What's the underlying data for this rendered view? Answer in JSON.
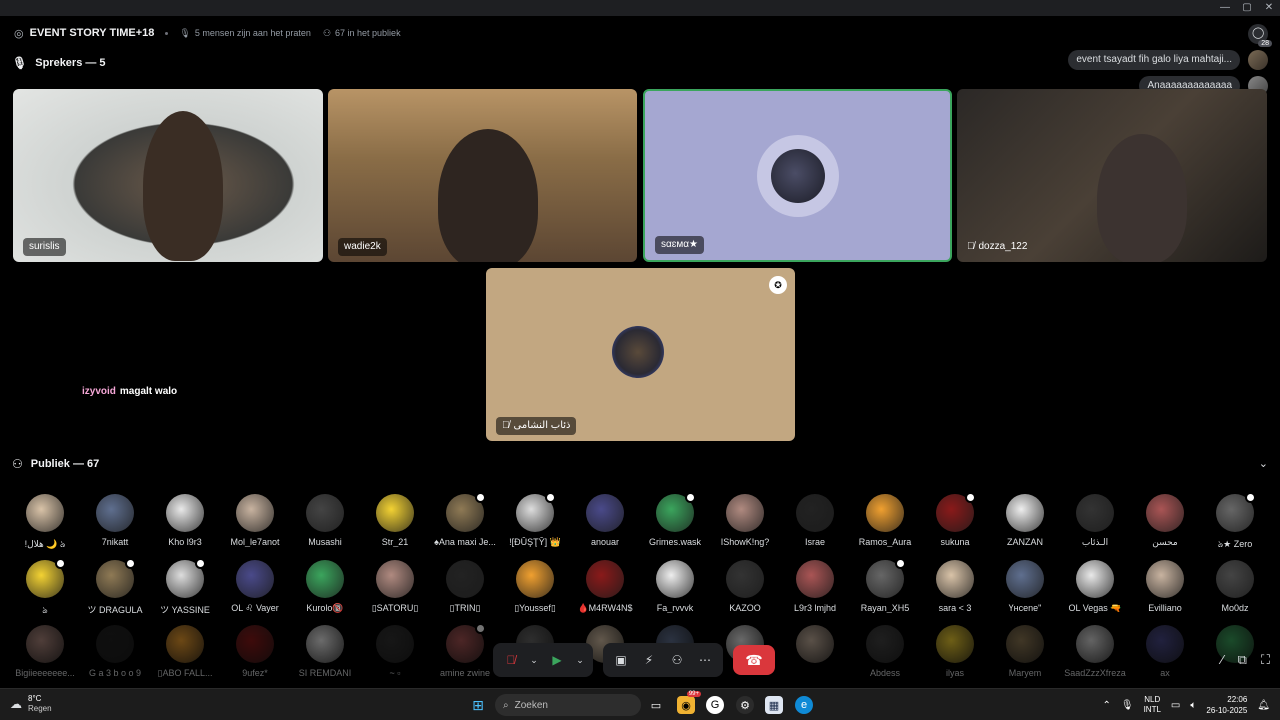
{
  "header": {
    "title": "EVENT STORY TIME+18",
    "speaking": "5 mensen zijn aan het praten",
    "audience_count": "67 in het publiek",
    "inbox_badge": "28"
  },
  "speakers": {
    "title": "Sprekers — 5",
    "tiles": [
      {
        "name": "surislis",
        "muted": false
      },
      {
        "name": "wadie2k",
        "muted": false
      },
      {
        "name": "sαɛмα★",
        "muted": false
      },
      {
        "name": "dozza_122",
        "muted": true
      },
      {
        "name": "ذئاب النشامى",
        "muted": true
      }
    ]
  },
  "floating_messages": [
    {
      "text": "event tsayadt fih galo liya mahtaji..."
    },
    {
      "text": "Anaaaaaaaaaaaaa"
    }
  ],
  "reaction_emoji": "😂",
  "inline_chat": {
    "user": "izyvoid",
    "message": "magalt walo"
  },
  "audience": {
    "title": "Publiek — 67",
    "rows": [
      [
        "!هلال 🌙 ঌ",
        "7nikatt",
        "Kho l9r3",
        "Mol_le7anot",
        "Musashi",
        "Str_21",
        "♠Ana maxi Je...",
        "![ĐŪŞŢŶ] 👑",
        "anouar",
        "Grimes.wask",
        "IShowK!ng?",
        "Israe",
        "Ramos_Aura",
        "sukuna",
        "ZANZAN",
        "الـذئاب",
        "محسن",
        "ঌ★ Zero"
      ],
      [
        "ঌ",
        "ツ DRAGULA",
        "ツ YASSINE",
        "OL ♌ Vayer",
        "Kurolo🔞",
        "▯SATORU▯",
        "▯TRIN▯",
        "▯Youssef▯",
        "🩸M4RW4N$",
        "Fa_rvvvk",
        "KAZOO",
        "L9r3 lmjhd",
        "Rayan_XH5",
        "sara < 3",
        "Үнcene\"",
        "OL Vegas 🔫",
        "Evilliano",
        "Mo0dz"
      ],
      [
        "Bigiieeeeeee...",
        "G a 3 b o o 9",
        "▯ABO FALL...",
        "9ufez*",
        "SI REMDANI",
        "~ ▫",
        "amine zwine",
        "",
        "",
        "",
        "",
        "",
        "Abdess",
        "ilyas",
        "Maryem",
        "SaadZzzXfreza",
        "ax",
        ""
      ]
    ]
  },
  "controls": {
    "mute": "microphone-muted",
    "camera": "camera",
    "share": "screen-share",
    "activity": "activities",
    "more": "more-options",
    "hangup": "disconnect"
  },
  "taskbar": {
    "weather_temp": "8°C",
    "weather_desc": "Regen",
    "search_placeholder": "Zoeken",
    "discord_badge": "99+",
    "lang1": "NLD",
    "lang2": "INTL",
    "time": "22:06",
    "date": "26-10-2025"
  },
  "colors": {
    "accent_green": "#3ba55d",
    "hangup_red": "#da373c",
    "username_pink": "#f7a8d8"
  }
}
